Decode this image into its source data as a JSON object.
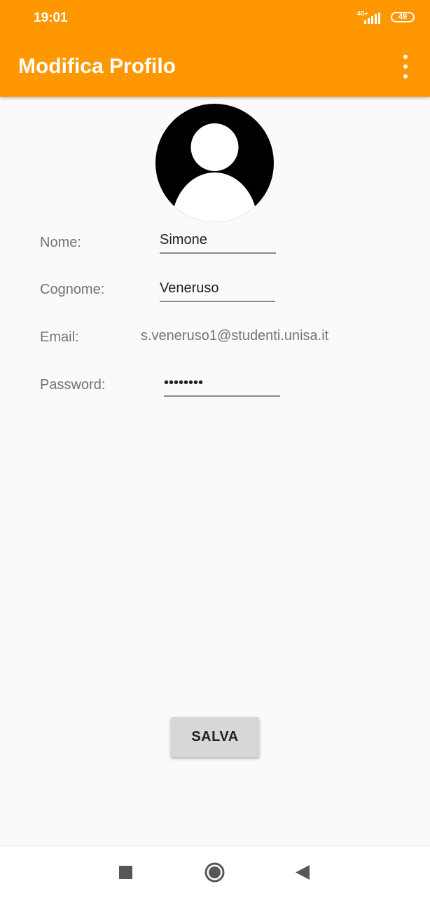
{
  "status_bar": {
    "time": "19:01",
    "network": "4G+",
    "battery": "49"
  },
  "app_bar": {
    "title": "Modifica Profilo",
    "menu_icon": "more-vert-icon"
  },
  "profile": {
    "avatar_icon": "account-circle-icon"
  },
  "form": {
    "name_label": "Nome:",
    "name_value": "Simone",
    "surname_label": "Cognome:",
    "surname_value": "Veneruso",
    "email_label": "Email:",
    "email_value": "s.veneruso1@studenti.unisa.it",
    "password_label": "Password:",
    "password_value": "••••••••"
  },
  "actions": {
    "save_label": "SALVA"
  },
  "nav_bar": {
    "recents_icon": "square-icon",
    "home_icon": "circle-icon",
    "back_icon": "triangle-back-icon"
  },
  "colors": {
    "accent": "#ff9800",
    "background": "#fafafa",
    "button": "#d6d7d7"
  }
}
